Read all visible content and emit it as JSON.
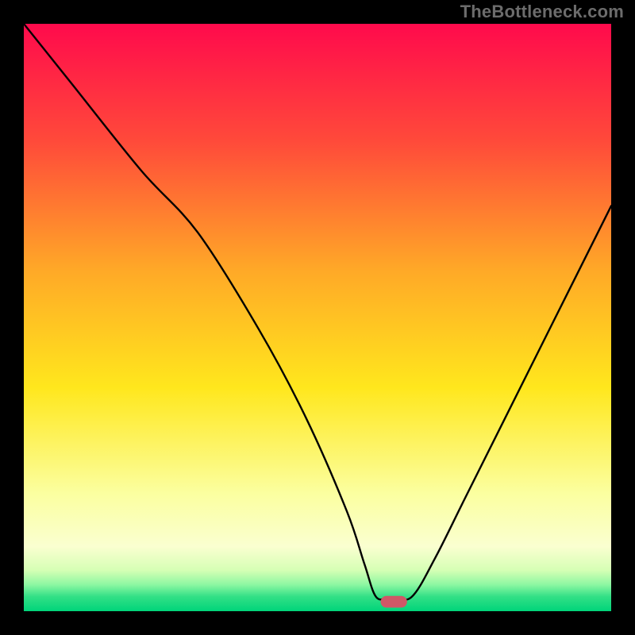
{
  "watermark": "TheBottleneck.com",
  "chart_data": {
    "type": "line",
    "title": "",
    "xlabel": "",
    "ylabel": "",
    "xlim": [
      0,
      100
    ],
    "ylim": [
      0,
      100
    ],
    "grid": false,
    "legend": false,
    "background_gradient": {
      "stops": [
        {
          "offset": 0.0,
          "color": "#ff0a4c"
        },
        {
          "offset": 0.2,
          "color": "#ff4a3a"
        },
        {
          "offset": 0.42,
          "color": "#ffa927"
        },
        {
          "offset": 0.62,
          "color": "#ffe71d"
        },
        {
          "offset": 0.8,
          "color": "#fbffa0"
        },
        {
          "offset": 0.89,
          "color": "#faffd0"
        },
        {
          "offset": 0.93,
          "color": "#d6ffb5"
        },
        {
          "offset": 0.955,
          "color": "#8cf7a2"
        },
        {
          "offset": 0.975,
          "color": "#33e086"
        },
        {
          "offset": 1.0,
          "color": "#00d47a"
        }
      ]
    },
    "series": [
      {
        "name": "bottleneck-curve",
        "x": [
          0,
          8,
          20,
          29.6,
          40,
          48,
          55,
          58,
          60,
          62.5,
          66,
          70,
          75,
          82,
          90,
          100
        ],
        "y": [
          100,
          90,
          75,
          64.5,
          48,
          33,
          17,
          8,
          2.4,
          2.4,
          2.4,
          9,
          19,
          33,
          49,
          69
        ]
      }
    ],
    "marker": {
      "name": "optimal-marker",
      "x": 63,
      "y": 1.6,
      "width": 4.5,
      "height": 2.0,
      "rx": 1.0,
      "color": "#cf5867"
    }
  }
}
